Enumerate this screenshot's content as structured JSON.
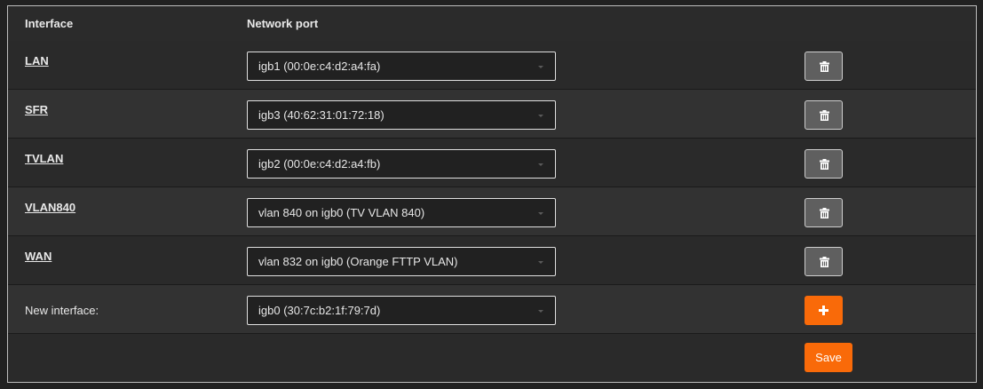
{
  "table": {
    "headers": {
      "interface": "Interface",
      "network_port": "Network port"
    },
    "rows": [
      {
        "interface": "LAN",
        "port": "igb1 (00:0e:c4:d2:a4:fa)"
      },
      {
        "interface": "SFR",
        "port": "igb3 (40:62:31:01:72:18)"
      },
      {
        "interface": "TVLAN",
        "port": "igb2 (00:0e:c4:d2:a4:fb)"
      },
      {
        "interface": "VLAN840",
        "port": "vlan 840 on igb0 (TV VLAN 840)"
      },
      {
        "interface": "WAN",
        "port": "vlan 832 on igb0 (Orange FTTP VLAN)"
      }
    ],
    "new_row": {
      "label": "New interface:",
      "port": "igb0 (30:7c:b2:1f:79:7d)"
    }
  },
  "actions": {
    "save_label": "Save",
    "delete_icon": "trash-icon",
    "add_icon": "plus-icon"
  },
  "colors": {
    "accent": "#f96a09",
    "delete_button": "#5f5f5f",
    "background": "#212121"
  }
}
